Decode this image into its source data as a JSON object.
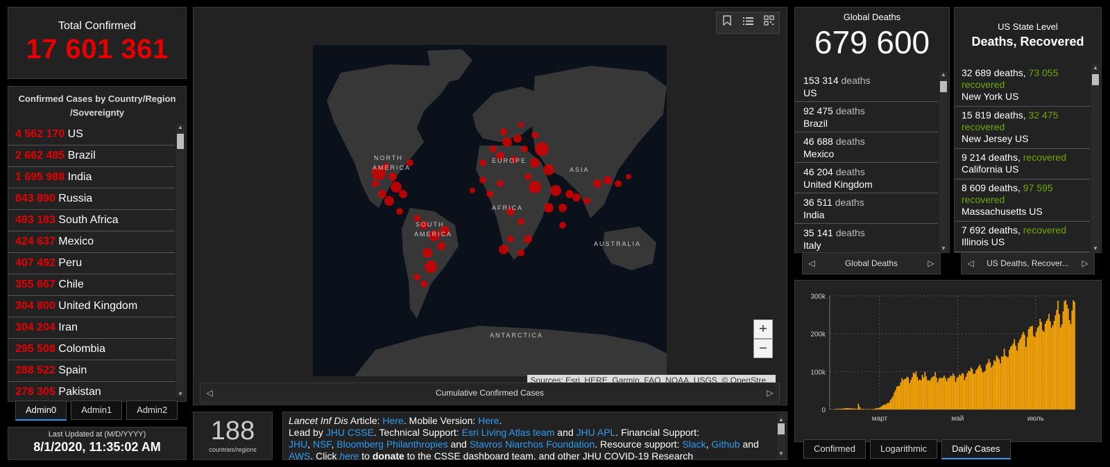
{
  "total": {
    "label": "Total Confirmed",
    "value": "17 601 361"
  },
  "countries": {
    "header_line1": "Confirmed Cases by Country/Region",
    "header_line2": "/Sovereignty",
    "items": [
      {
        "count": "4 562 170",
        "name": "US"
      },
      {
        "count": "2 662 485",
        "name": "Brazil"
      },
      {
        "count": "1 695 988",
        "name": "India"
      },
      {
        "count": "843 890",
        "name": "Russia"
      },
      {
        "count": "493 183",
        "name": "South Africa"
      },
      {
        "count": "424 637",
        "name": "Mexico"
      },
      {
        "count": "407 492",
        "name": "Peru"
      },
      {
        "count": "355 667",
        "name": "Chile"
      },
      {
        "count": "304 800",
        "name": "United Kingdom"
      },
      {
        "count": "304 204",
        "name": "Iran"
      },
      {
        "count": "295 508",
        "name": "Colombia"
      },
      {
        "count": "288 522",
        "name": "Spain"
      },
      {
        "count": "278 305",
        "name": "Pakistan"
      }
    ],
    "tabs": [
      "Admin0",
      "Admin1",
      "Admin2"
    ]
  },
  "updated": {
    "label": "Last Updated at (M/D/YYYY)",
    "value": "8/1/2020, 11:35:02 AM"
  },
  "map": {
    "labels": {
      "north_america_1": "NORTH",
      "north_america_2": "AMERICA",
      "south_america_1": "SOUTH",
      "south_america_2": "AMERICA",
      "europe": "EUROPE",
      "asia": "ASIA",
      "africa": "AFRICA",
      "australia": "AUSTRALIA",
      "antarctica": "ANTARCTICA"
    },
    "attribution": "Sources: Esri, HERE, Garmin, FAO, NOAA, USGS, © OpenStre...",
    "zoom_in": "+",
    "zoom_out": "−",
    "nav_label": "Cumulative Confirmed Cases",
    "tool_icons": [
      "bookmark-icon",
      "list-icon",
      "qr-grid-icon"
    ]
  },
  "count": {
    "value": "188",
    "label": "countries/regions"
  },
  "info": {
    "journal": "Lancet Inf Dis",
    "article": " Article: ",
    "here1": "Here",
    "mobile": ". Mobile Version: ",
    "here2": "Here",
    "lead": ".",
    "led_by": "Lead by ",
    "jhu_csse": "JHU CSSE",
    "tech": ". Technical Support: ",
    "esri": "Esri Living Atlas team",
    "and1": " and ",
    "jhu_apl": "JHU APL",
    "fin": ". Financial Support:",
    "jhu": "JHU",
    "comma1": ", ",
    "nsf": "NSF",
    "comma2": ", ",
    "bloomberg": "Bloomberg Philanthropies",
    "and2": " and ",
    "stavros": "Stavros Niarchos Foundation",
    "res": ". Resource support: ",
    "slack": "Slack",
    "comma3": ", ",
    "github": "Github",
    "and3": " and",
    "aws": "AWS",
    "click": ". Click ",
    "here3": "here",
    "to": " to ",
    "donate": "donate",
    "rest": " to the CSSE dashboard team, and other JHU COVID-19 Research"
  },
  "deaths": {
    "label": "Global Deaths",
    "value": "679 600",
    "unit": "deaths",
    "items": [
      {
        "count": "153 314",
        "name": "US"
      },
      {
        "count": "92 475",
        "name": "Brazil"
      },
      {
        "count": "46 688",
        "name": "Mexico"
      },
      {
        "count": "46 204",
        "name": "United Kingdom"
      },
      {
        "count": "36 511",
        "name": "India"
      },
      {
        "count": "35 141",
        "name": "Italy"
      }
    ],
    "nav_label": "Global Deaths"
  },
  "usstate": {
    "label": "US State Level",
    "title": "Deaths, Recovered",
    "items": [
      {
        "deaths": "32 689 deaths,",
        "recovered": "73 055",
        "rlabel": "recovered",
        "name": "New York US"
      },
      {
        "deaths": "15 819 deaths,",
        "recovered": "32 475",
        "rlabel": "recovered",
        "name": "New Jersey US"
      },
      {
        "deaths": "9 214 deaths,",
        "recovered": "",
        "rlabel": "recovered",
        "name": "California US"
      },
      {
        "deaths": "8 609 deaths,",
        "recovered": "97 595",
        "rlabel": "recovered",
        "name": "Massachusetts US"
      },
      {
        "deaths": "7 692 deaths,",
        "recovered": "",
        "rlabel": "recovered",
        "name": "Illinois US"
      }
    ],
    "nav_label": "US Deaths, Recover..."
  },
  "chart_data": {
    "type": "bar",
    "yticks": [
      "0",
      "100k",
      "200k",
      "300k"
    ],
    "ylim": [
      0,
      300000
    ],
    "xticks": [
      "март",
      "май",
      "июль"
    ],
    "x_start": "2020-01-22",
    "x_end": "2020-08-01",
    "color": "#ffaa00",
    "values": [
      600,
      300,
      500,
      700,
      1400,
      1700,
      1700,
      2000,
      1700,
      2100,
      2600,
      3200,
      3900,
      3700,
      3200,
      3500,
      2900,
      2600,
      3000,
      2500,
      2000,
      1800,
      15100,
      6400,
      2000,
      1500,
      2100,
      500,
      1100,
      1000,
      1200,
      1400,
      700,
      1300,
      1600,
      2000,
      3900,
      3600,
      4200,
      5600,
      8600,
      10400,
      13500,
      12400,
      15700,
      17100,
      18100,
      25300,
      29700,
      34700,
      44800,
      50900,
      60400,
      62500,
      62000,
      71100,
      82500,
      77200,
      80300,
      81400,
      86400,
      84600,
      69600,
      78100,
      85500,
      97600,
      94200,
      100400,
      86100,
      76600,
      79600,
      76700,
      91700,
      84400,
      99100,
      87500,
      77400,
      77000,
      76500,
      83100,
      86600,
      87800,
      98700,
      84500,
      72100,
      81400,
      84900,
      82000,
      84300,
      89400,
      83500,
      74900,
      83600,
      83300,
      89300,
      87300,
      95500,
      89400,
      72600,
      84100,
      86200,
      92400,
      89600,
      95900,
      94900,
      77800,
      86500,
      95700,
      102000,
      100800,
      110500,
      106700,
      93400,
      95300,
      104000,
      108000,
      113800,
      118700,
      109300,
      98000,
      98600,
      102300,
      118000,
      123000,
      133400,
      124100,
      111000,
      116500,
      130200,
      127300,
      143000,
      137800,
      132400,
      121800,
      140200,
      139500,
      160700,
      142300,
      138700,
      138800,
      157400,
      165400,
      169000,
      174800,
      185900,
      168700,
      155600,
      175900,
      183600,
      189500,
      198400,
      205000,
      196900,
      164900,
      191400,
      211600,
      218100,
      219300,
      221000,
      194600,
      190600,
      205000,
      215300,
      220500,
      239500,
      231300,
      209400,
      204800,
      226500,
      234000,
      239100,
      252900,
      232700,
      215100,
      222900,
      233800,
      248800,
      262400,
      287300,
      251700,
      216800,
      224800,
      258900,
      285400,
      289200,
      277200,
      266600,
      236200,
      225300,
      261400,
      288500,
      284300
    ]
  },
  "chart_tabs": [
    "Confirmed",
    "Logarithmic",
    "Daily Cases"
  ]
}
